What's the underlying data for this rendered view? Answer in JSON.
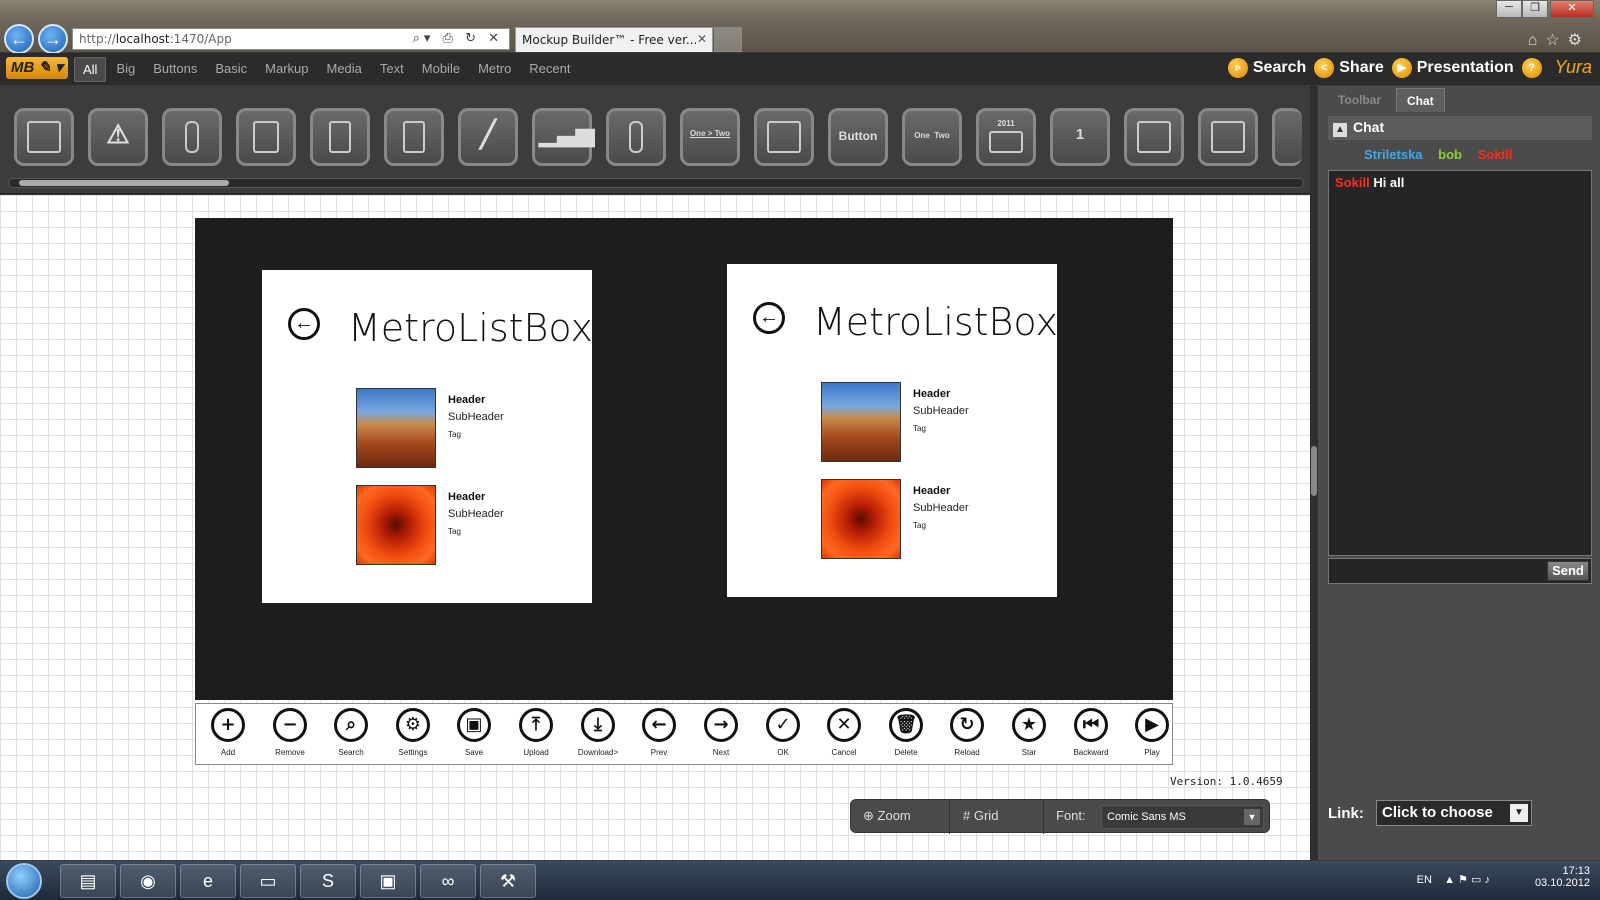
{
  "browser": {
    "url_prefix": "http://",
    "url_host": "localhost",
    "url_path": ":1470/App",
    "tab_title": "Mockup Builder™ - Free ver...",
    "window_controls": [
      "─",
      "❐",
      "✕"
    ]
  },
  "menu": {
    "logo": "MB",
    "items": [
      "All",
      "Big",
      "Buttons",
      "Basic",
      "Markup",
      "Media",
      "Text",
      "Mobile",
      "Metro",
      "Recent"
    ],
    "active": "All",
    "actions": {
      "search": "Search",
      "share": "Share",
      "presentation": "Presentation",
      "help": "?",
      "user": "Yura"
    }
  },
  "toolbar": {
    "tool_labels": {
      "breadcrumb": "One > Two",
      "button": "Button",
      "tabs_one": "One",
      "tabs_two": "Two",
      "calendar_year": "2011",
      "badge": "1"
    }
  },
  "canvas": {
    "listboxes": [
      {
        "title": "MetroListBox",
        "items": [
          {
            "header": "Header",
            "subheader": "SubHeader",
            "tag": "Tag",
            "image": "canyon"
          },
          {
            "header": "Header",
            "subheader": "SubHeader",
            "tag": "Tag",
            "image": "flower"
          }
        ]
      },
      {
        "title": "MetroListBox",
        "items": [
          {
            "header": "Header",
            "subheader": "SubHeader",
            "tag": "Tag",
            "image": "canyon"
          },
          {
            "header": "Header",
            "subheader": "SubHeader",
            "tag": "Tag",
            "image": "flower"
          }
        ]
      }
    ],
    "appbar": [
      {
        "label": "Add",
        "glyph": "+"
      },
      {
        "label": "Remove",
        "glyph": "−"
      },
      {
        "label": "Search",
        "glyph": "⌕"
      },
      {
        "label": "Settings",
        "glyph": "⚙"
      },
      {
        "label": "Save",
        "glyph": "▣"
      },
      {
        "label": "Upload",
        "glyph": "⤒"
      },
      {
        "label": "Download>",
        "glyph": "⤓"
      },
      {
        "label": "Prev",
        "glyph": "←"
      },
      {
        "label": "Next",
        "glyph": "→"
      },
      {
        "label": "OK",
        "glyph": "✓"
      },
      {
        "label": "Cancel",
        "glyph": "✕"
      },
      {
        "label": "Delete",
        "glyph": "🗑"
      },
      {
        "label": "Reload",
        "glyph": "↻"
      },
      {
        "label": "Star",
        "glyph": "★"
      },
      {
        "label": "Backward",
        "glyph": "⏮"
      },
      {
        "label": "Play",
        "glyph": "▶"
      }
    ],
    "version": "Version: 1.0.4659",
    "bottom": {
      "zoom": "Zoom",
      "grid": "Grid",
      "font_label": "Font:",
      "font_value": "Comic Sans MS"
    }
  },
  "panel": {
    "tabs": [
      "Toolbar",
      "Chat"
    ],
    "active_tab": "Chat",
    "chat_title": "Chat",
    "users": [
      {
        "name": "Striletska",
        "color": "#3fa9e6"
      },
      {
        "name": "bob",
        "color": "#8ccf3a"
      },
      {
        "name": "Sokill",
        "color": "#ff2a1a"
      }
    ],
    "messages": [
      {
        "user": "Sokill",
        "user_color": "#ff2a1a",
        "text": "Hi all"
      }
    ],
    "send_label": "Send",
    "link_label": "Link:",
    "link_value": "Click to choose"
  },
  "taskbar": {
    "lang": "EN",
    "time": "17:13",
    "date": "03.10.2012"
  },
  "colors": {
    "accent": "#f5a623",
    "canvas_dark": "#1e1e1e"
  }
}
